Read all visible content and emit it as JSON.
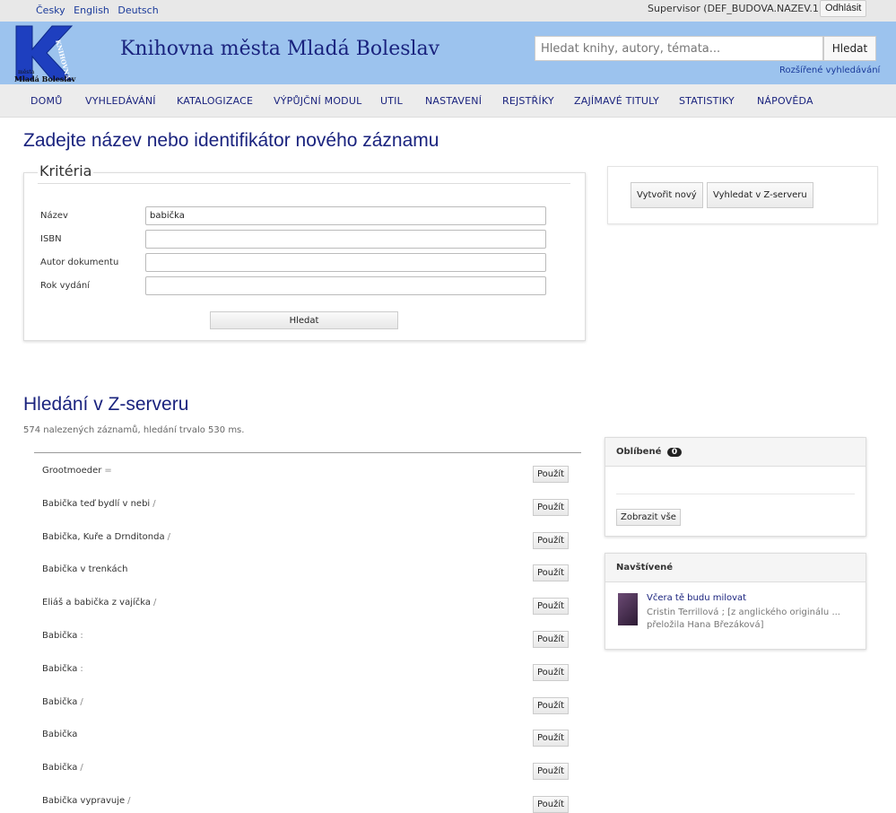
{
  "top": {
    "languages": [
      "Česky",
      "English",
      "Deutsch"
    ],
    "user": "Supervisor (DEF_BUDOVA.NAZEV.1)",
    "logout": "Odhlásit"
  },
  "header": {
    "title": "Knihovna města Mladá Boleslav",
    "logo_text": "K",
    "logo_side": "KNIHOVNA",
    "logo_bottom": "Mladá Boleslav",
    "logo_top": "města",
    "search_placeholder": "Hledat knihy, autory, témata...",
    "search_button": "Hledat",
    "advanced": "Rozšířené vyhledávání"
  },
  "nav": [
    "DOMŮ",
    "VYHLEDÁVÁNÍ",
    "KATALOGIZACE",
    "VÝPŮJČNÍ MODUL",
    "UTIL",
    "NASTAVENÍ",
    "REJSTŘÍKY",
    "ZAJÍMAVÉ TITULY",
    "STATISTIKY",
    "NÁPOVĚDA"
  ],
  "main": {
    "heading": "Zadejte název nebo identifikátor nového záznamu",
    "criteria": {
      "legend": "Kritéria",
      "fields": [
        {
          "label": "Název",
          "value": "babička"
        },
        {
          "label": "ISBN",
          "value": ""
        },
        {
          "label": "Autor dokumentu",
          "value": ""
        },
        {
          "label": "Rok vydání",
          "value": ""
        }
      ],
      "search_button": "Hledat"
    },
    "actions": {
      "create": "Vytvořit nový",
      "zserver": "Vyhledat v Z-serveru"
    },
    "zserver": {
      "heading": "Hledání v Z-serveru",
      "found": "574 nalezených záznamů, hledání trvalo 530 ms.",
      "use_label": "Použít",
      "results": [
        {
          "title": "Grootmoeder",
          "sep": "="
        },
        {
          "title": "Babička teď bydlí v nebi",
          "sep": "/"
        },
        {
          "title": "Babička, Kuře a Drnditonda",
          "sep": "/"
        },
        {
          "title": "Babička v trenkách",
          "sep": ""
        },
        {
          "title": "Eliáš a babička z vajíčka",
          "sep": "/"
        },
        {
          "title": "Babička",
          "sep": ":"
        },
        {
          "title": "Babička",
          "sep": ":"
        },
        {
          "title": "Babička",
          "sep": "/"
        },
        {
          "title": "Babička",
          "sep": ""
        },
        {
          "title": "Babička",
          "sep": "/"
        },
        {
          "title": "Babička vypravuje",
          "sep": "/"
        }
      ]
    }
  },
  "sidebar": {
    "favorites": {
      "title": "Oblíbené",
      "count": "0",
      "show_all": "Zobrazit vše"
    },
    "visited": {
      "title": "Navštívené",
      "item_title": "Včera tě budu milovat",
      "item_author": "Cristin Terrillová ; [z anglického originálu ... přeložila Hana Březáková]"
    }
  }
}
